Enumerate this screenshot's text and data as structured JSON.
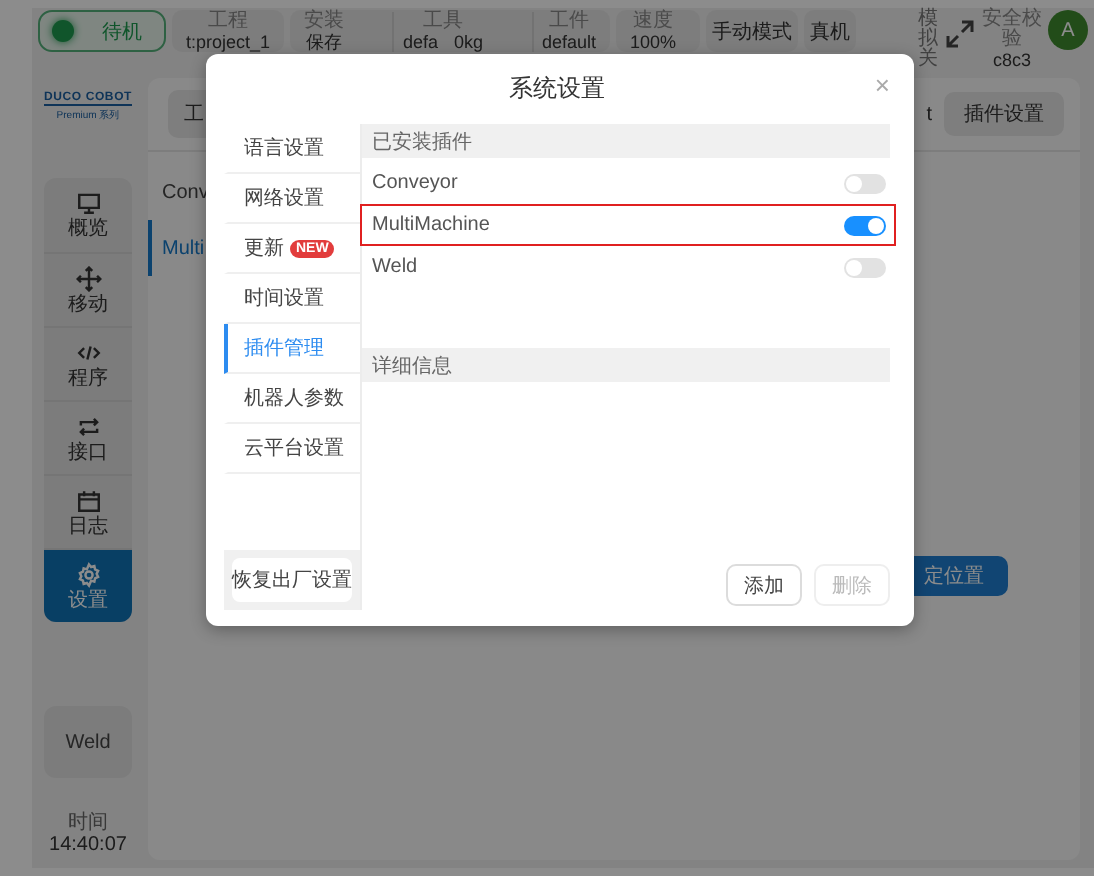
{
  "top_bar": {
    "status": {
      "label": "待机"
    },
    "groups": [
      {
        "items": [
          {
            "label": "工程",
            "values": [
              "t:project_1"
            ]
          }
        ]
      },
      {
        "items": [
          {
            "label": "安装",
            "values": [
              "保存"
            ]
          },
          {
            "label": "工具",
            "values": [
              "defa",
              "0kg"
            ]
          },
          {
            "label": "工件",
            "values": [
              "default"
            ]
          }
        ]
      },
      {
        "items": [
          {
            "label": "速度",
            "values": [
              "100%"
            ]
          }
        ]
      }
    ],
    "buttons": [
      "手动模式",
      "真机"
    ],
    "vertical_label": "模拟关",
    "safety": {
      "label": "安全校验",
      "value": "c8c3"
    },
    "avatar": "A"
  },
  "sidebar": {
    "logo": "DUCO COBOT",
    "logo_sub": "Premium 系列",
    "nav": [
      {
        "label": "概览",
        "kind": "monitor",
        "selected": false
      },
      {
        "label": "移动",
        "kind": "move",
        "selected": false
      },
      {
        "label": "程序",
        "kind": "code",
        "selected": false
      },
      {
        "label": "接口",
        "kind": "repeat",
        "selected": false
      },
      {
        "label": "日志",
        "kind": "calendar",
        "selected": false
      },
      {
        "label": "设置",
        "kind": "gear",
        "selected": true
      }
    ],
    "plugin_button": "Weld",
    "time_label": "时间",
    "time": "14:40:07"
  },
  "main": {
    "tab": "工",
    "partial_text": "t",
    "plugin_settings_button": "插件设置",
    "plugin_list": [
      {
        "label": "Conv",
        "selected": false
      },
      {
        "label": "Multi",
        "selected": true
      }
    ],
    "action_button": "定位置"
  },
  "settings_dialog": {
    "title": "系统设置",
    "close": "×",
    "menu": [
      {
        "label": "语言设置",
        "selected": false
      },
      {
        "label": "网络设置",
        "selected": false
      },
      {
        "label": "更新",
        "badge": "NEW",
        "selected": false
      },
      {
        "label": "时间设置",
        "selected": false
      },
      {
        "label": "插件管理",
        "selected": true
      },
      {
        "label": "机器人参数",
        "selected": false
      },
      {
        "label": "云平台设置",
        "selected": false
      }
    ],
    "reset_button": "恢复出厂设置",
    "installed_header": "已安装插件",
    "plugins": [
      {
        "name": "Conveyor",
        "on": false,
        "highlighted": false
      },
      {
        "name": "MultiMachine",
        "on": true,
        "highlighted": true
      },
      {
        "name": "Weld",
        "on": false,
        "highlighted": false
      }
    ],
    "details_header": "详细信息",
    "buttons": [
      {
        "label": "添加",
        "disabled": false
      },
      {
        "label": "删除",
        "disabled": true
      }
    ]
  }
}
